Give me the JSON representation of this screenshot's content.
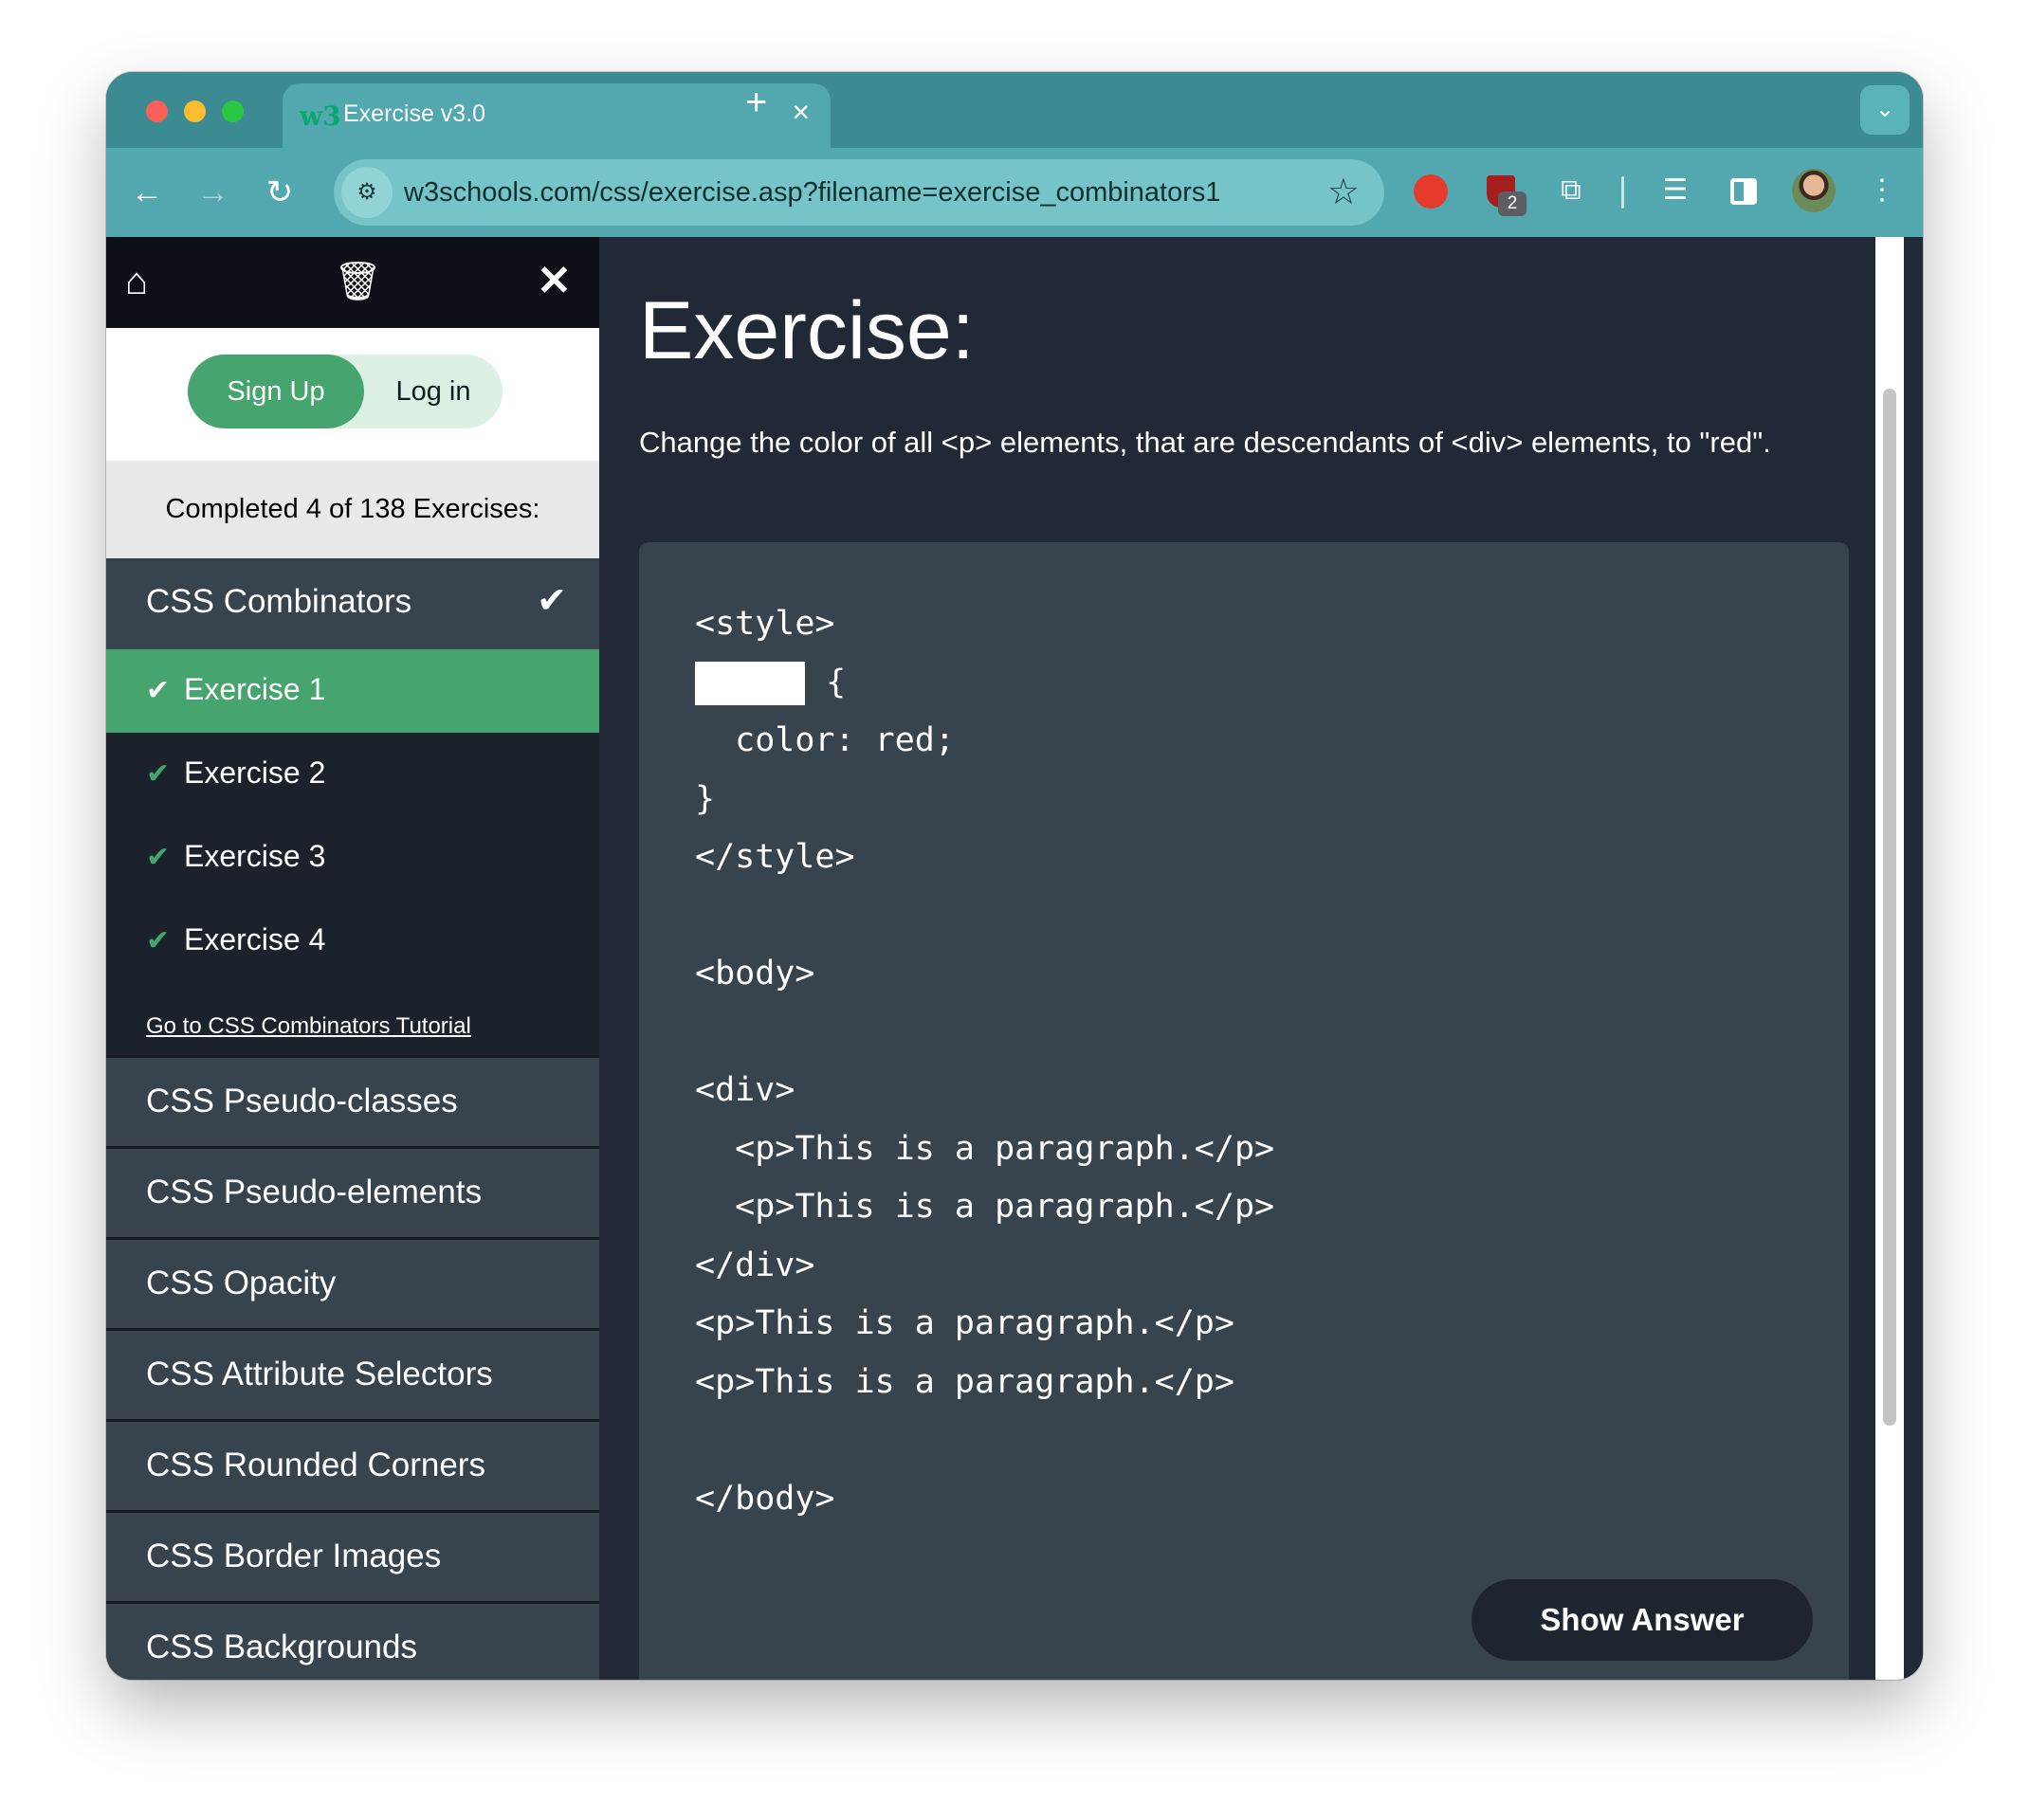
{
  "browser": {
    "tab_title": "Exercise v3.0",
    "tab_favicon": "w3",
    "url": "w3schools.com/css/exercise.asp?filename=exercise_combinators1",
    "ublock_badge": "2"
  },
  "sidebar": {
    "signup_label": "Sign Up",
    "login_label": "Log in",
    "progress_text": "Completed 4 of 138 Exercises:",
    "active_section": "CSS Combinators",
    "exercises": [
      {
        "label": "Exercise 1",
        "active": true
      },
      {
        "label": "Exercise 2",
        "active": false
      },
      {
        "label": "Exercise 3",
        "active": false
      },
      {
        "label": "Exercise 4",
        "active": false
      }
    ],
    "tutorial_link": "Go to CSS Combinators Tutorial",
    "topics": [
      "CSS Pseudo-classes",
      "CSS Pseudo-elements",
      "CSS Opacity",
      "CSS Attribute Selectors",
      "CSS Rounded Corners",
      "CSS Border Images",
      "CSS Backgrounds"
    ]
  },
  "main": {
    "heading": "Exercise:",
    "instruction": "Change the color of all <p> elements, that are descendants of <div> elements, to \"red\".",
    "code_lines": [
      "<style>",
      "{",
      "  color: red;",
      "}",
      "</style>",
      "",
      "<body>",
      "",
      "<div>",
      "  <p>This is a paragraph.</p>",
      "  <p>This is a paragraph.</p>",
      "</div>",
      "<p>This is a paragraph.</p>",
      "<p>This is a paragraph.</p>",
      "",
      "</body>"
    ],
    "answer_value": "",
    "show_answer_label": "Show Answer"
  },
  "colors": {
    "w3_green": "#46a56e",
    "chrome_teal": "#52a8ae",
    "page_dark": "#202935",
    "code_bg": "#38444d"
  }
}
